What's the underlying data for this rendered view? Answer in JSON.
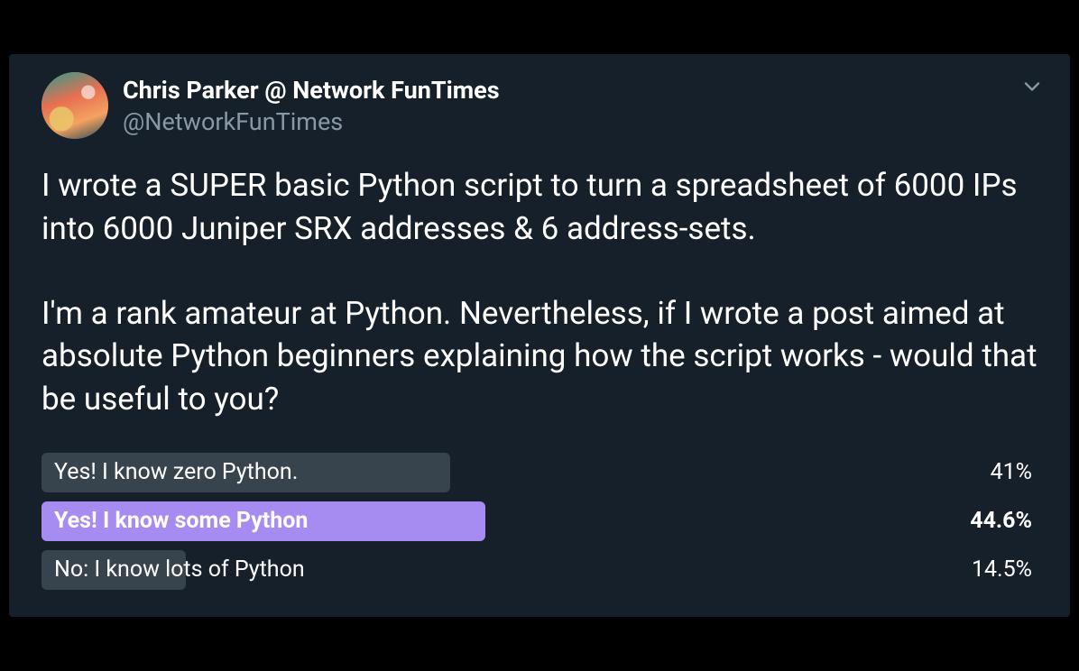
{
  "author": {
    "display_name": "Chris Parker @ Network FunTimes",
    "handle": "@NetworkFunTimes"
  },
  "tweet_text": "I wrote a SUPER basic Python script to turn a spreadsheet of 6000 IPs into 6000 Juniper SRX addresses & 6 address-sets.\n\nI'm a rank amateur at Python. Nevertheless, if I wrote a post aimed at absolute Python beginners explaining how the script works - would that be useful to you?",
  "poll": {
    "options": [
      {
        "label": "Yes! I know zero Python.",
        "pct": 41,
        "pct_text": "41%",
        "winner": false
      },
      {
        "label": "Yes! I know some Python",
        "pct": 44.6,
        "pct_text": "44.6%",
        "winner": true
      },
      {
        "label": "No: I know lots of Python",
        "pct": 14.5,
        "pct_text": "14.5%",
        "winner": false
      }
    ]
  }
}
